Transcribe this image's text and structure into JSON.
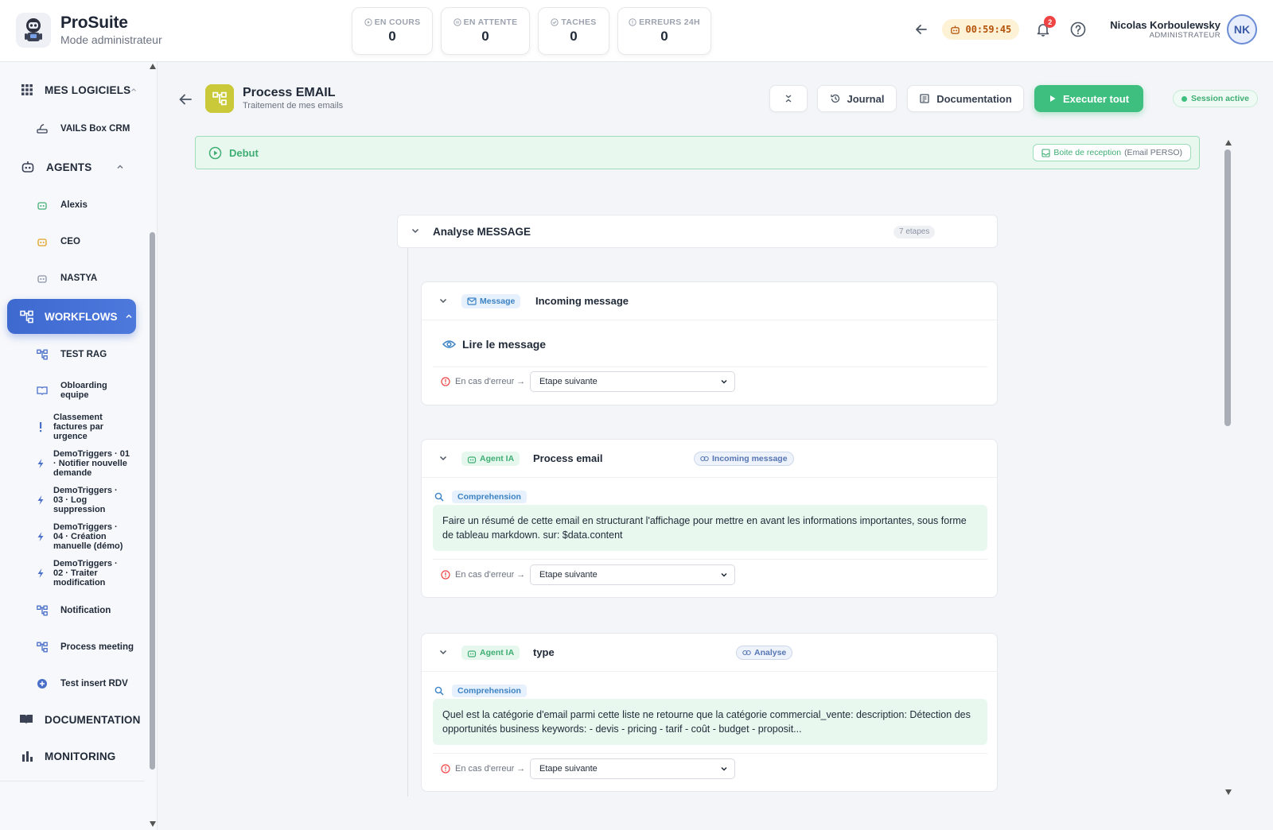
{
  "app": {
    "title": "ProSuite",
    "subtitle": "Mode administrateur"
  },
  "stats": [
    {
      "label": "EN COURS",
      "value": "0",
      "icon": "play-circle-icon"
    },
    {
      "label": "EN ATTENTE",
      "value": "0",
      "icon": "pause-circle-icon"
    },
    {
      "label": "TACHES",
      "value": "0",
      "icon": "check-circle-icon"
    },
    {
      "label": "ERREURS 24H",
      "value": "0",
      "icon": "alert-circle-icon"
    }
  ],
  "header": {
    "timer": "00:59:45",
    "notifications_count": "2",
    "user_name": "Nicolas Korboulewsky",
    "user_role": "ADMINISTRATEUR",
    "user_initials": "NK"
  },
  "sidebar": {
    "sections": {
      "logiciels": "MES LOGICIELS",
      "agents": "AGENTS",
      "workflows": "WORKFLOWS",
      "documentation": "DOCUMENTATION",
      "monitoring": "MONITORING"
    },
    "logiciels_items": [
      "VAILS Box CRM"
    ],
    "agents_items": [
      "Alexis",
      "CEO",
      "NASTYA"
    ],
    "workflow_items": [
      "TEST RAG",
      "Obloarding equipe",
      "Classement factures par urgence",
      "DemoTriggers · 01 · Notifier nouvelle demande",
      "DemoTriggers · 03 · Log suppression",
      "DemoTriggers · 04 · Création manuelle (démo)",
      "DemoTriggers · 02 · Traiter modification",
      "Notification",
      "Process meeting",
      "Test insert RDV"
    ]
  },
  "process": {
    "title": "Process EMAIL",
    "subtitle": "Traitement de mes emails",
    "journal_label": "Journal",
    "documentation_label": "Documentation",
    "run_all_label": "Executer tout",
    "session_label": "Session active",
    "start_label": "Debut",
    "inbox_label": "Boite de reception",
    "inbox_source": "(Email PERSO)"
  },
  "group": {
    "title": "Analyse MESSAGE",
    "steps_count": "7 etapes"
  },
  "steps": [
    {
      "type_label": "Message",
      "title": "Incoming message",
      "action": "Lire le message",
      "error_label": "En cas d'erreur →",
      "error_option": "Etape suivante"
    },
    {
      "type_label": "Agent IA",
      "title": "Process email",
      "link_label": "Incoming message",
      "mode_label": "Comprehension",
      "prompt": "Faire un résumé de cette email en structurant l'affichage pour mettre en avant les informations importantes, sous forme de tableau markdown. sur: $data.content",
      "error_label": "En cas d'erreur →",
      "error_option": "Etape suivante"
    },
    {
      "type_label": "Agent IA",
      "title": "type",
      "link_label": "Analyse",
      "mode_label": "Comprehension",
      "prompt": "Quel est la catégorie d'email parmi cette liste ne retourne que la catégorie commercial_vente: description: Détection des opportunités business keywords: - devis - pricing - tarif - coût - budget - proposit...",
      "error_label": "En cas d'erreur →",
      "error_option": "Etape suivante"
    }
  ],
  "colors": {
    "accent_blue": "#3e6ad0",
    "success_green": "#3fbf7f",
    "warning_bg": "#fdf1d6",
    "error_red": "#ef4444"
  }
}
